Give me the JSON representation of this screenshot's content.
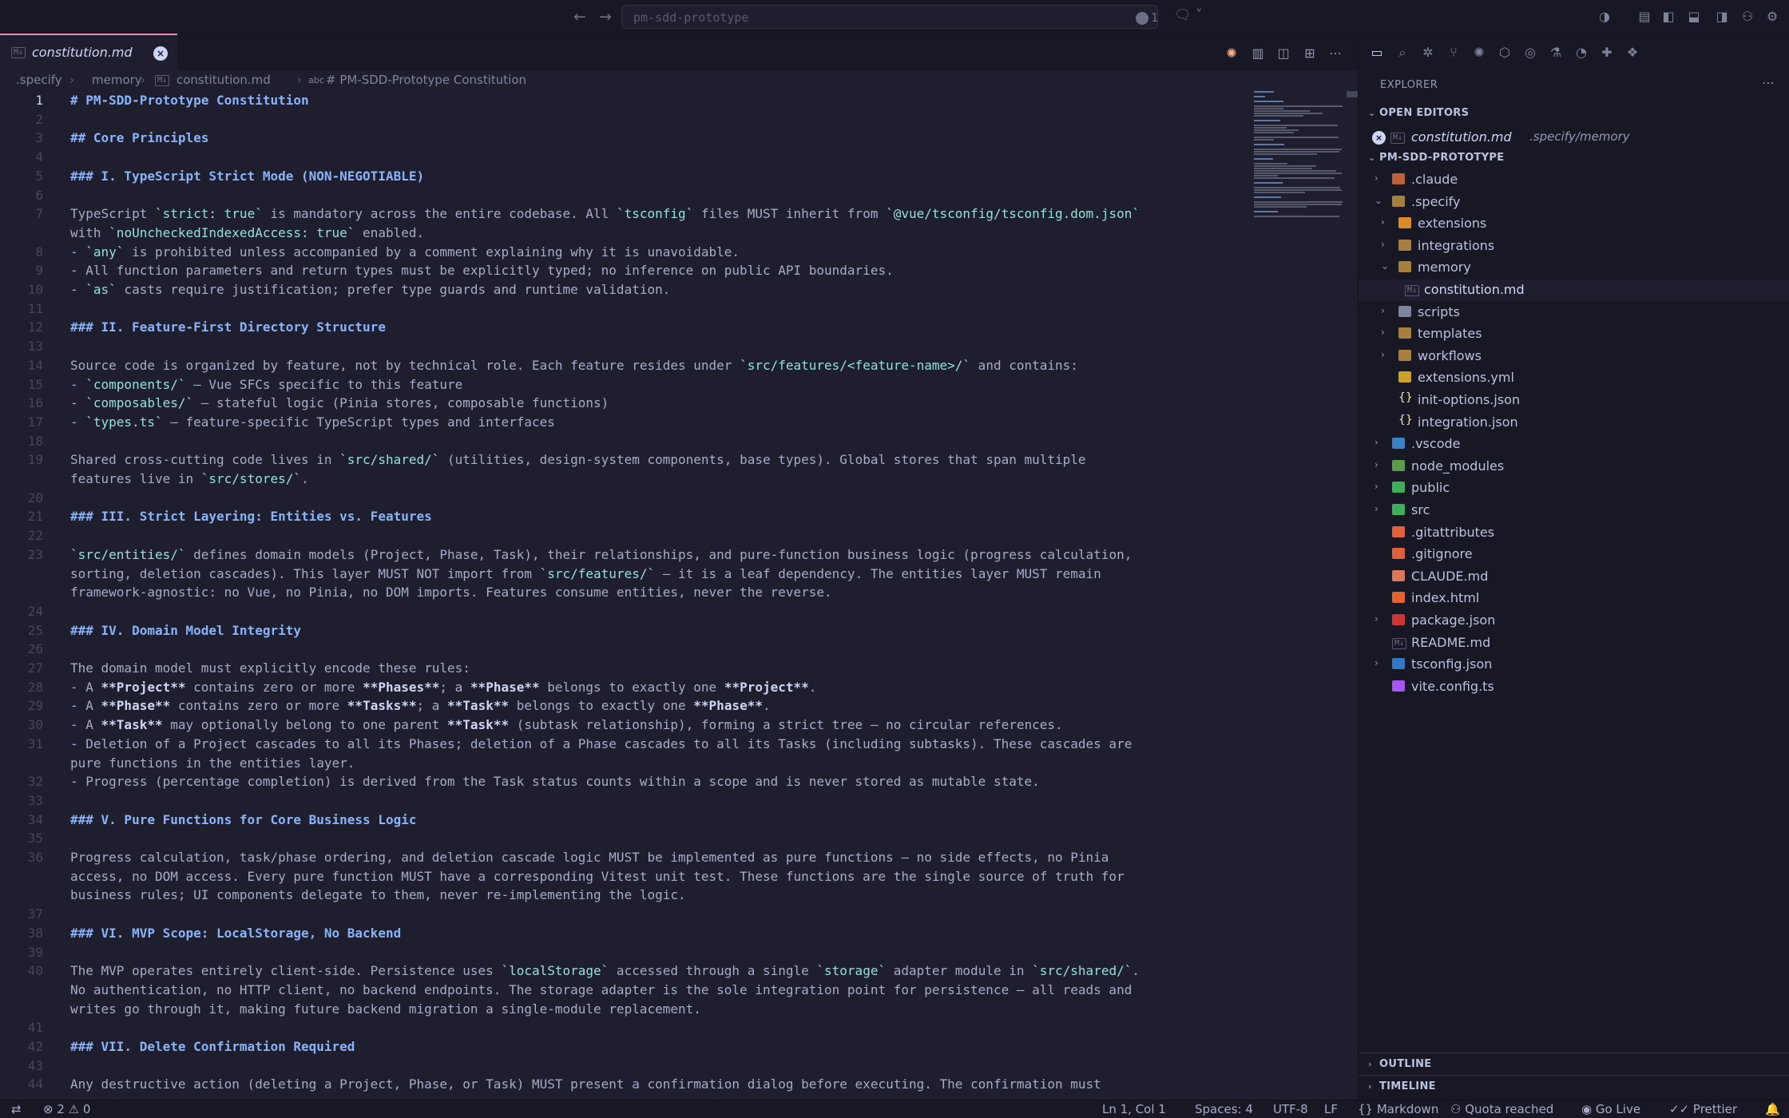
{
  "window": {
    "command_center_text": "pm-sdd-prototype",
    "issue_count": "1"
  },
  "tab": {
    "title": "constitution.md",
    "file_type_badge": "M↓"
  },
  "breadcrumb": {
    "parts": [
      ".specify",
      "memory",
      "constitution.md",
      "# PM-SDD-Prototype Constitution"
    ]
  },
  "editor": {
    "current_line": 1,
    "lines": [
      {
        "n": "1",
        "text": "# PM-SDD-Prototype Constitution"
      },
      {
        "n": "2",
        "text": ""
      },
      {
        "n": "3",
        "text": "## Core Principles"
      },
      {
        "n": "4",
        "text": ""
      },
      {
        "n": "5",
        "text": "### I. TypeScript Strict Mode (NON-NEGOTIABLE)"
      },
      {
        "n": "6",
        "text": ""
      },
      {
        "n": "7",
        "text": "TypeScript `strict: true` is mandatory across the entire codebase. All `tsconfig` files MUST inherit from `@vue/tsconfig/tsconfig.dom.json`",
        "cont": [
          "with `noUncheckedIndexedAccess: true` enabled."
        ]
      },
      {
        "n": "8",
        "text": "- `any` is prohibited unless accompanied by a comment explaining why it is unavoidable."
      },
      {
        "n": "9",
        "text": "- All function parameters and return types must be explicitly typed; no inference on public API boundaries."
      },
      {
        "n": "10",
        "text": "- `as` casts require justification; prefer type guards and runtime validation."
      },
      {
        "n": "11",
        "text": ""
      },
      {
        "n": "12",
        "text": "### II. Feature-First Directory Structure"
      },
      {
        "n": "13",
        "text": ""
      },
      {
        "n": "14",
        "text": "Source code is organized by feature, not by technical role. Each feature resides under `src/features/<feature-name>/` and contains:"
      },
      {
        "n": "15",
        "text": "- `components/` — Vue SFCs specific to this feature"
      },
      {
        "n": "16",
        "text": "- `composables/` — stateful logic (Pinia stores, composable functions)"
      },
      {
        "n": "17",
        "text": "- `types.ts` — feature-specific TypeScript types and interfaces"
      },
      {
        "n": "18",
        "text": ""
      },
      {
        "n": "19",
        "text": "Shared cross-cutting code lives in `src/shared/` (utilities, design-system components, base types). Global stores that span multiple",
        "cont": [
          "features live in `src/stores/`."
        ]
      },
      {
        "n": "20",
        "text": ""
      },
      {
        "n": "21",
        "text": "### III. Strict Layering: Entities vs. Features"
      },
      {
        "n": "22",
        "text": ""
      },
      {
        "n": "23",
        "text": "`src/entities/` defines domain models (Project, Phase, Task), their relationships, and pure-function business logic (progress calculation,",
        "cont": [
          "sorting, deletion cascades). This layer MUST NOT import from `src/features/` — it is a leaf dependency. The entities layer MUST remain",
          "framework-agnostic: no Vue, no Pinia, no DOM imports. Features consume entities, never the reverse."
        ]
      },
      {
        "n": "24",
        "text": ""
      },
      {
        "n": "25",
        "text": "### IV. Domain Model Integrity"
      },
      {
        "n": "26",
        "text": ""
      },
      {
        "n": "27",
        "text": "The domain model must explicitly encode these rules:"
      },
      {
        "n": "28",
        "text": "- A **Project** contains zero or more **Phases**; a **Phase** belongs to exactly one **Project**."
      },
      {
        "n": "29",
        "text": "- A **Phase** contains zero or more **Tasks**; a **Task** belongs to exactly one **Phase**."
      },
      {
        "n": "30",
        "text": "- A **Task** may optionally belong to one parent **Task** (subtask relationship), forming a strict tree — no circular references."
      },
      {
        "n": "31",
        "text": "- Deletion of a Project cascades to all its Phases; deletion of a Phase cascades to all its Tasks (including subtasks). These cascades are",
        "cont": [
          "pure functions in the entities layer."
        ]
      },
      {
        "n": "32",
        "text": "- Progress (percentage completion) is derived from the Task status counts within a scope and is never stored as mutable state."
      },
      {
        "n": "33",
        "text": ""
      },
      {
        "n": "34",
        "text": "### V. Pure Functions for Core Business Logic"
      },
      {
        "n": "35",
        "text": ""
      },
      {
        "n": "36",
        "text": "Progress calculation, task/phase ordering, and deletion cascade logic MUST be implemented as pure functions — no side effects, no Pinia",
        "cont": [
          "access, no DOM access. Every pure function MUST have a corresponding Vitest unit test. These functions are the single source of truth for",
          "business rules; UI components delegate to them, never re-implementing the logic."
        ]
      },
      {
        "n": "37",
        "text": ""
      },
      {
        "n": "38",
        "text": "### VI. MVP Scope: LocalStorage, No Backend"
      },
      {
        "n": "39",
        "text": ""
      },
      {
        "n": "40",
        "text": "The MVP operates entirely client-side. Persistence uses `localStorage` accessed through a single `storage` adapter module in `src/shared/`.",
        "cont": [
          "No authentication, no HTTP client, no backend endpoints. The storage adapter is the sole integration point for persistence — all reads and",
          "writes go through it, making future backend migration a single-module replacement."
        ]
      },
      {
        "n": "41",
        "text": ""
      },
      {
        "n": "42",
        "text": "### VII. Delete Confirmation Required"
      },
      {
        "n": "43",
        "text": ""
      },
      {
        "n": "44",
        "text": "Any destructive action (deleting a Project, Phase, or Task) MUST present a confirmation dialog before executing. The confirmation must"
      }
    ]
  },
  "sidebar": {
    "title": "EXPLORER",
    "open_editors_label": "OPEN EDITORS",
    "open_editor": {
      "name": "constitution.md",
      "path": ".specify/memory"
    },
    "project_label": "PM-SDD-PROTOTYPE",
    "tree": [
      {
        "name": ".claude",
        "depth": 1,
        "arrow": "›",
        "icon": "#c0603a"
      },
      {
        "name": ".specify",
        "depth": 1,
        "arrow": "⌄",
        "icon": "#a6803f"
      },
      {
        "name": "extensions",
        "depth": 2,
        "arrow": "›",
        "icon": "#d98a2b"
      },
      {
        "name": "integrations",
        "depth": 2,
        "arrow": "›",
        "icon": "#a6803f"
      },
      {
        "name": "memory",
        "depth": 2,
        "arrow": "⌄",
        "icon": "#a6803f"
      },
      {
        "name": "constitution.md",
        "depth": 3,
        "arrow": "",
        "icon": "md",
        "selected": true
      },
      {
        "name": "scripts",
        "depth": 2,
        "arrow": "›",
        "icon": "#7f849c"
      },
      {
        "name": "templates",
        "depth": 2,
        "arrow": "›",
        "icon": "#a6803f"
      },
      {
        "name": "workflows",
        "depth": 2,
        "arrow": "›",
        "icon": "#a6803f"
      },
      {
        "name": "extensions.yml",
        "depth": 2,
        "arrow": "",
        "icon": "#c9a227"
      },
      {
        "name": "init-options.json",
        "depth": 2,
        "arrow": "",
        "icon": "json"
      },
      {
        "name": "integration.json",
        "depth": 2,
        "arrow": "",
        "icon": "json"
      },
      {
        "name": ".vscode",
        "depth": 1,
        "arrow": "›",
        "icon": "#3b82c4"
      },
      {
        "name": "node_modules",
        "depth": 1,
        "arrow": "›",
        "icon": "#5a9e4b"
      },
      {
        "name": "public",
        "depth": 1,
        "arrow": "›",
        "icon": "#3fae5a"
      },
      {
        "name": "src",
        "depth": 1,
        "arrow": "›",
        "icon": "#3fae5a"
      },
      {
        "name": ".gitattributes",
        "depth": 1,
        "arrow": "",
        "icon": "#e0603c"
      },
      {
        "name": ".gitignore",
        "depth": 1,
        "arrow": "",
        "icon": "#e0603c"
      },
      {
        "name": "CLAUDE.md",
        "depth": 1,
        "arrow": "",
        "icon": "#d97757"
      },
      {
        "name": "index.html",
        "depth": 1,
        "arrow": "",
        "icon": "#e5632f"
      },
      {
        "name": "package.json",
        "depth": 1,
        "arrow": "›",
        "icon": "#cc3534"
      },
      {
        "name": "README.md",
        "depth": 1,
        "arrow": "",
        "icon": "md"
      },
      {
        "name": "tsconfig.json",
        "depth": 1,
        "arrow": "›",
        "icon": "#3178c6"
      },
      {
        "name": "vite.config.ts",
        "depth": 1,
        "arrow": "",
        "icon": "#a855f7"
      }
    ],
    "outline_label": "OUTLINE",
    "timeline_label": "TIMELINE"
  },
  "statusbar": {
    "errors": "2",
    "warnings": "0",
    "position": "Ln 1, Col 1",
    "spaces": "Spaces: 4",
    "encoding": "UTF-8",
    "eol": "LF",
    "language": "Markdown",
    "quota": "Quota reached",
    "golive": "Go Live",
    "prettier": "Prettier"
  }
}
